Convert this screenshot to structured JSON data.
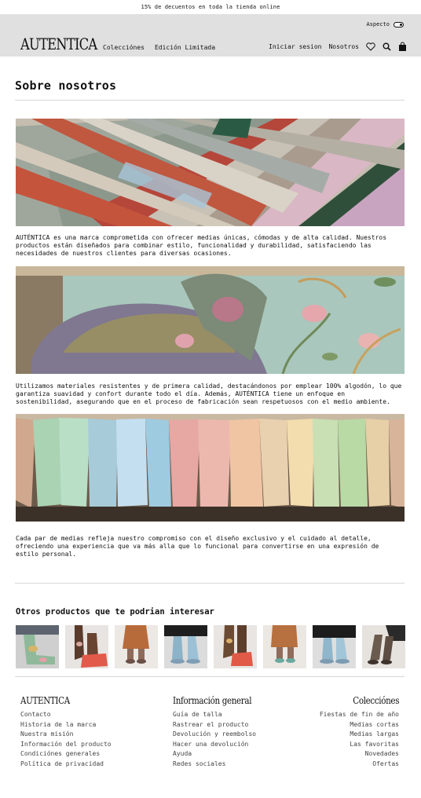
{
  "announcement": "15% de decuentos en toda la tienda online",
  "header": {
    "aspect_label": "Aspecto",
    "logo": "AUTENTICA",
    "nav_left": [
      "Colecciónes",
      "Edición Limitada"
    ],
    "nav_right": [
      "Iniciar sesion",
      "Nosotros"
    ],
    "icons": [
      "heart-icon",
      "search-icon",
      "bag-icon"
    ]
  },
  "main": {
    "title": "Sobre nosotros",
    "paragraphs": [
      "AUTÉNTICA es una marca comprometida con ofrecer medias únicas, cómodas y de alta calidad. Nuestros productos están diseñados para combinar estilo, funcionalidad y durabilidad, satisfaciendo las necesidades de nuestros clientes para diversas ocasiones.",
      "Utilizamos materiales resistentes y de primera calidad, destacándonos por emplear 100% algodón, lo que garantiza suavidad y confort durante todo el día. Además, AUTÉNTICA tiene un enfoque en sostenibilidad, asegurando que en el proceso de fabricación sean respetuosos con el medio ambiente.",
      "Cada par de medias refleja nuestro compromiso con el diseño exclusivo y el cuidado al detalle, ofreciendo una experiencia que va más alla que lo funcional para convertirse en una expresión de estilo personal."
    ]
  },
  "related": {
    "title": "Otros productos que te podrian interesar"
  },
  "footer": {
    "col1": {
      "title": "AUTENTICA",
      "links": [
        "Contacto",
        "Historia de la marca",
        "Nuestra misión",
        "Información del producto",
        "Condiciónes generales",
        "Política de privacidad"
      ]
    },
    "col2": {
      "title": "Información general",
      "links": [
        "Guía de talla",
        "Rastrear el producto",
        "Devolución y reembolso",
        "Hacer una devolución",
        "Ayuda",
        "Redes sociales"
      ]
    },
    "col3": {
      "title": "Colecciónes",
      "links": [
        "Fiestas de fin de año",
        "Medias cortas",
        "Medias largas",
        "Las favoritas",
        "Novedades",
        "Ofertas"
      ]
    }
  }
}
